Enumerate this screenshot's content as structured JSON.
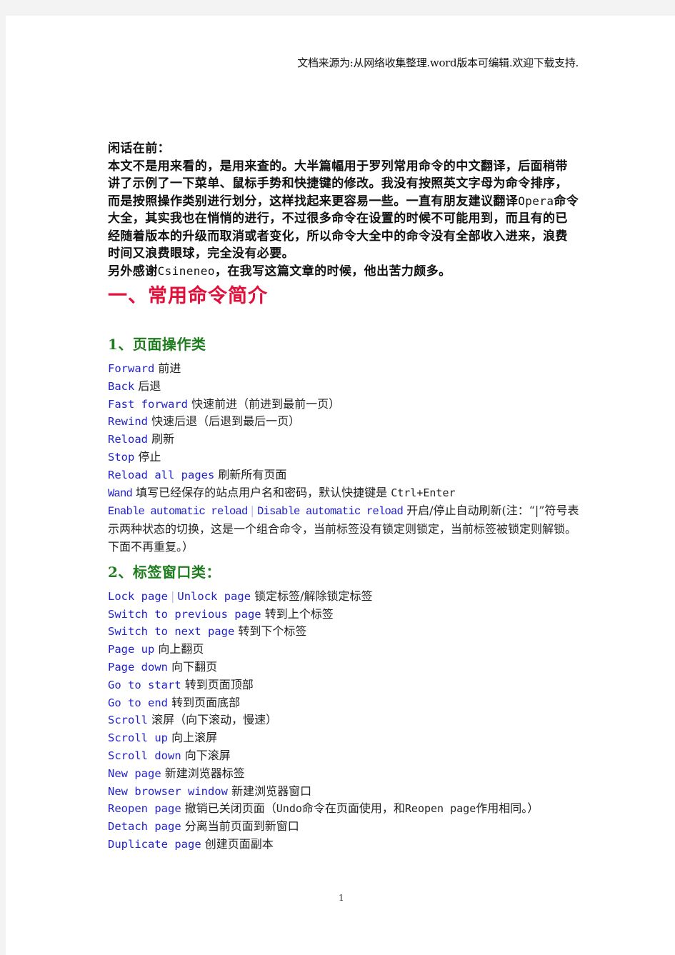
{
  "header_note": "文档来源为:从网络收集整理.word版本可编辑.欢迎下载支持.",
  "intro": {
    "title": "闲话在前：",
    "para1_a": "本文不是用来看的，是用来查的。大半篇幅用于罗列常用命令的中文翻译，后面稍带讲了示例了一下菜单、鼠标手势和快捷键的修改。我没有按照英文字母为命令排序，而是按照操作类别进行划分，这样找起来更容易一些。一直有朋友建议翻译",
    "para1_opera": "Opera",
    "para1_b": "命令大全，其实我也在悄悄的进行，不过很多命令在设置的时候不可能用到，而且有的已经随着版本的升级而取消或者变化，所以命令大全中的命令没有全部收入进来，浪费时间又浪费眼球，完全没有必要。",
    "para2_a": "另外感谢",
    "para2_name": "Csineneo",
    "para2_b": "，在我写这篇文章的时候，他出苦力颇多。"
  },
  "section1": {
    "title": "一、常用命令简介",
    "sub1": {
      "title": "1、页面操作类",
      "items": [
        {
          "cmd": "Forward",
          "desc": "前进"
        },
        {
          "cmd": "Back",
          "desc": "后退"
        },
        {
          "cmd": "Fast forward",
          "desc": "快速前进（前进到最前一页）"
        },
        {
          "cmd": "Rewind",
          "desc": "快速后退（后退到最后一页）"
        },
        {
          "cmd": "Reload",
          "desc": "刷新"
        },
        {
          "cmd": "Stop",
          "desc": "停止"
        },
        {
          "cmd": "Reload all pages",
          "desc": "刷新所有页面"
        },
        {
          "cmd": "Wand",
          "desc": "填写已经保存的站点用户名和密码，默认快捷键是",
          "shortcut": "Ctrl+Enter"
        },
        {
          "cmd": "Enable automatic reload",
          "sep": "|",
          "cmd2": "Disable automatic reload",
          "desc": "开启/停止自动刷新(注：“|”符号表示两种状态的切换，这是一个组合命令，当前标签没有锁定则锁定，当前标签被锁定则解锁。下面不再重复。）"
        }
      ]
    },
    "sub2": {
      "title": "2、标签窗口类：",
      "items": [
        {
          "cmd": "Lock page",
          "sep": "|",
          "cmd2": "Unlock page",
          "desc": "锁定标签/解除锁定标签"
        },
        {
          "cmd": "Switch to previous page",
          "desc": "转到上个标签"
        },
        {
          "cmd": "Switch to next page",
          "desc": "转到下个标签"
        },
        {
          "cmd": "Page up",
          "desc": "向上翻页"
        },
        {
          "cmd": "Page down",
          "desc": "向下翻页"
        },
        {
          "cmd": "Go to start",
          "desc": "转到页面顶部"
        },
        {
          "cmd": "Go to end",
          "desc": "转到页面底部"
        },
        {
          "cmd": "Scroll",
          "desc": "滚屏（向下滚动，慢速）"
        },
        {
          "cmd": "Scroll up",
          "desc": "向上滚屏"
        },
        {
          "cmd": "Scroll down",
          "desc": "向下滚屏"
        },
        {
          "cmd": "New page",
          "desc": "新建浏览器标签"
        },
        {
          "cmd": "New browser window",
          "desc": "新建浏览器窗口"
        },
        {
          "cmd": "Reopen page",
          "desc_a": "撤销已关闭页面（",
          "undo": "Undo",
          "desc_b": "命令在页面使用，和",
          "ref": "Reopen page",
          "desc_c": "作用相同。）"
        },
        {
          "cmd": "Detach page",
          "desc": "分离当前页面到新窗口"
        },
        {
          "cmd": "Duplicate page",
          "desc": "创建页面副本"
        }
      ]
    }
  },
  "page_number": "1"
}
